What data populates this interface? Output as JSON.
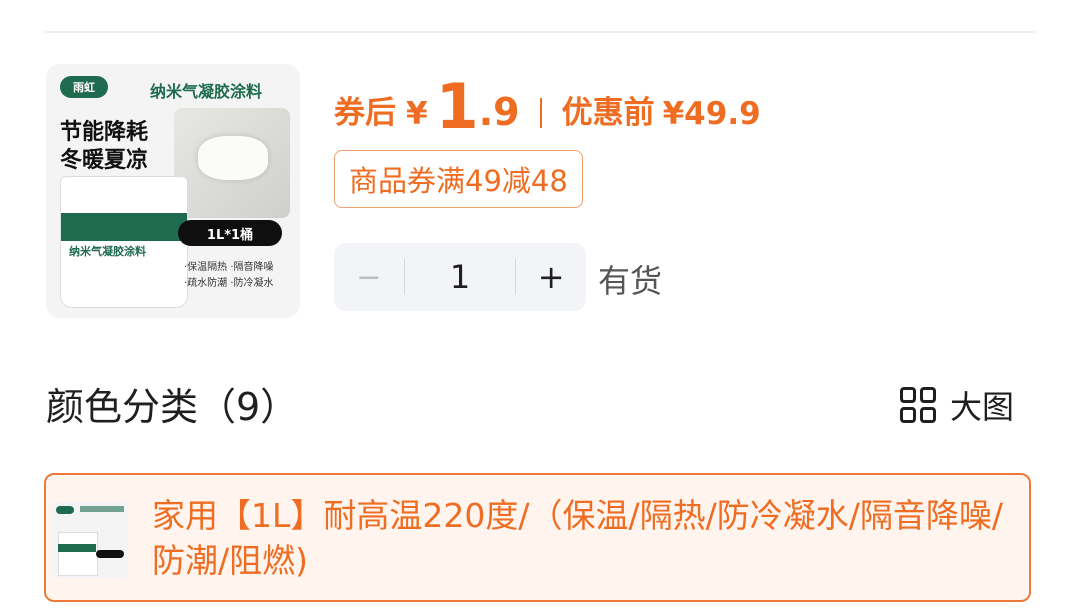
{
  "product": {
    "thumbnail": {
      "brand": "雨虹",
      "header": "纳米气凝胶涂料",
      "title_line1": "节能降耗",
      "title_line2": "冬暖夏凉",
      "bucket_label": "纳米气凝胶涂料",
      "size": "1L*1桶",
      "features_line1": "·保温隔热 ·隔音降噪",
      "features_line2": "·疏水防潮 ·防冷凝水"
    },
    "price": {
      "coupon_prefix": "券后",
      "currency": "¥",
      "price_integer": "1",
      "price_decimal": ".9",
      "original_label": "优惠前",
      "original_price": "¥49.9",
      "accent_color": "#ee6d22"
    },
    "coupon_tag": "商品券满49减48",
    "quantity": {
      "minus": "−",
      "value": "1",
      "plus": "+"
    },
    "stock_status": "有货"
  },
  "variants": {
    "section_title": "颜色分类（9）",
    "view_toggle_label": "大图",
    "view_toggle_icon": "grid-icon",
    "selected": {
      "label": "家用【1L】耐高温220度/（保温/隔热/防冷凝水/隔音降噪/防潮/阻燃)"
    }
  }
}
